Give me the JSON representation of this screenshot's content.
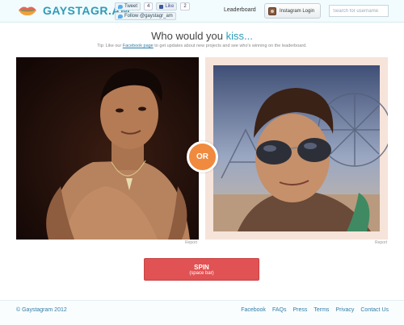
{
  "header": {
    "brand": "GAYSTAGR.AM",
    "tweet": {
      "label": "Tweet",
      "count": "4"
    },
    "like": {
      "label": "Like",
      "count": "2"
    },
    "follow": {
      "label": "Follow @gaystagr_am"
    },
    "leaderboard": "Leaderboard",
    "instagram_login": "Instagram Login",
    "search": {
      "placeholder": "Search for username",
      "value": ""
    }
  },
  "main": {
    "question_prefix": "Who would you ",
    "question_keyword": "kiss...",
    "tip_prefix": "Tip: Like our ",
    "tip_link": "Facebook page",
    "tip_suffix": " to get updates about new projects and see who's winning on the leaderboard.",
    "or_label": "OR",
    "left_report": "Report",
    "right_report": "Report",
    "spin_label": "SPIN",
    "spin_hint": "(space bar)"
  },
  "footer": {
    "copyright": "© Gaystagram 2012",
    "links": [
      "Facebook",
      "FAQs",
      "Press",
      "Terms",
      "Privacy",
      "Contact Us"
    ]
  },
  "colors": {
    "accent": "#2f9bb6",
    "spin_button": "#e05253",
    "or_badge": "#ef8a3f"
  },
  "icons": [
    "lips-logo-icon",
    "twitter-bird-icon",
    "facebook-thumb-icon",
    "instagram-camera-icon"
  ]
}
